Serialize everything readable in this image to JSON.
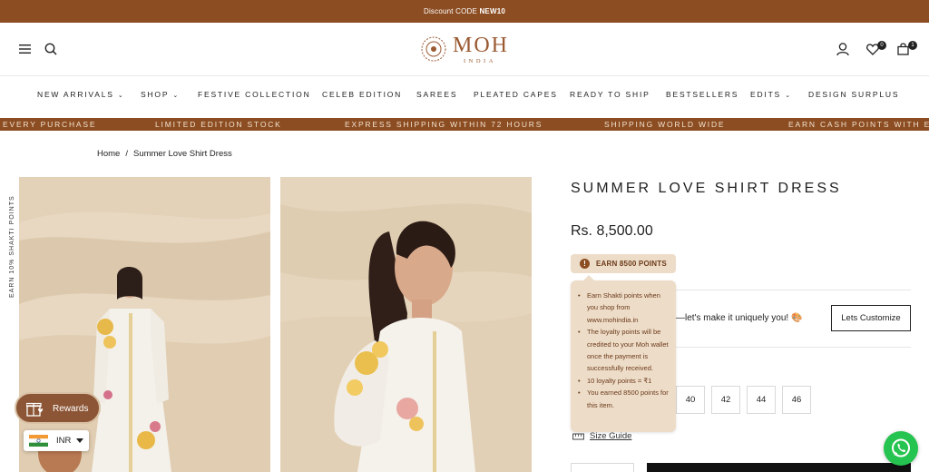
{
  "announcement": {
    "prefix": "Discount CODE ",
    "code": "NEW10"
  },
  "header": {
    "logo_text": "MOH",
    "logo_sub": "INDIA",
    "wishlist_count": "0",
    "cart_count": "1"
  },
  "nav": [
    {
      "label": "NEW ARRIVALS",
      "dropdown": true
    },
    {
      "label": "SHOP",
      "dropdown": true
    },
    {
      "label": "FESTIVE COLLECTION",
      "dropdown": false
    },
    {
      "label": "CELEB EDITION",
      "dropdown": false
    },
    {
      "label": "SAREES",
      "dropdown": false
    },
    {
      "label": "PLEATED CAPES",
      "dropdown": false
    },
    {
      "label": "READY TO SHIP",
      "dropdown": false
    },
    {
      "label": "BESTSELLERS",
      "dropdown": false
    },
    {
      "label": "EDITS",
      "dropdown": true
    },
    {
      "label": "DESIGN SURPLUS",
      "dropdown": false
    }
  ],
  "nav_chevron": "⌄",
  "ticker": [
    "EVERY PURCHASE",
    "LIMITED EDITION STOCK",
    "EXPRESS SHIPPING WITHIN 72 HOURS",
    "SHIPPING WORLD WIDE",
    "EARN CASH POINTS WITH E"
  ],
  "breadcrumb": {
    "home": "Home",
    "separator": "/",
    "current": "Summer Love Shirt Dress"
  },
  "side_label": "EARN 10% SHAKTI POINTS",
  "product": {
    "title": "SUMMER LOVE SHIRT DRESS",
    "price": "Rs. 8,500.00",
    "earn_label": "EARN 8500 POINTS",
    "earn_icon": "!",
    "customize_text": "—let's make it uniquely you! 🎨",
    "customize_button": "Lets Customize",
    "sizes": [
      "40",
      "42",
      "44",
      "46"
    ],
    "size_guide": "Size Guide"
  },
  "tooltip": {
    "items": [
      "Earn Shakti points when you shop from www.mohindia.in",
      "The loyalty points will be credited to your Moh wallet once the payment is successfully received.",
      "10 loyalty points = ₹1",
      "You earned 8500 points for this item."
    ]
  },
  "rewards": {
    "label": "Rewards"
  },
  "currency": {
    "code": "INR"
  },
  "colors": {
    "brand": "#8c4d22",
    "tooltip_bg": "#eddcc8",
    "whatsapp": "#25c34f"
  }
}
